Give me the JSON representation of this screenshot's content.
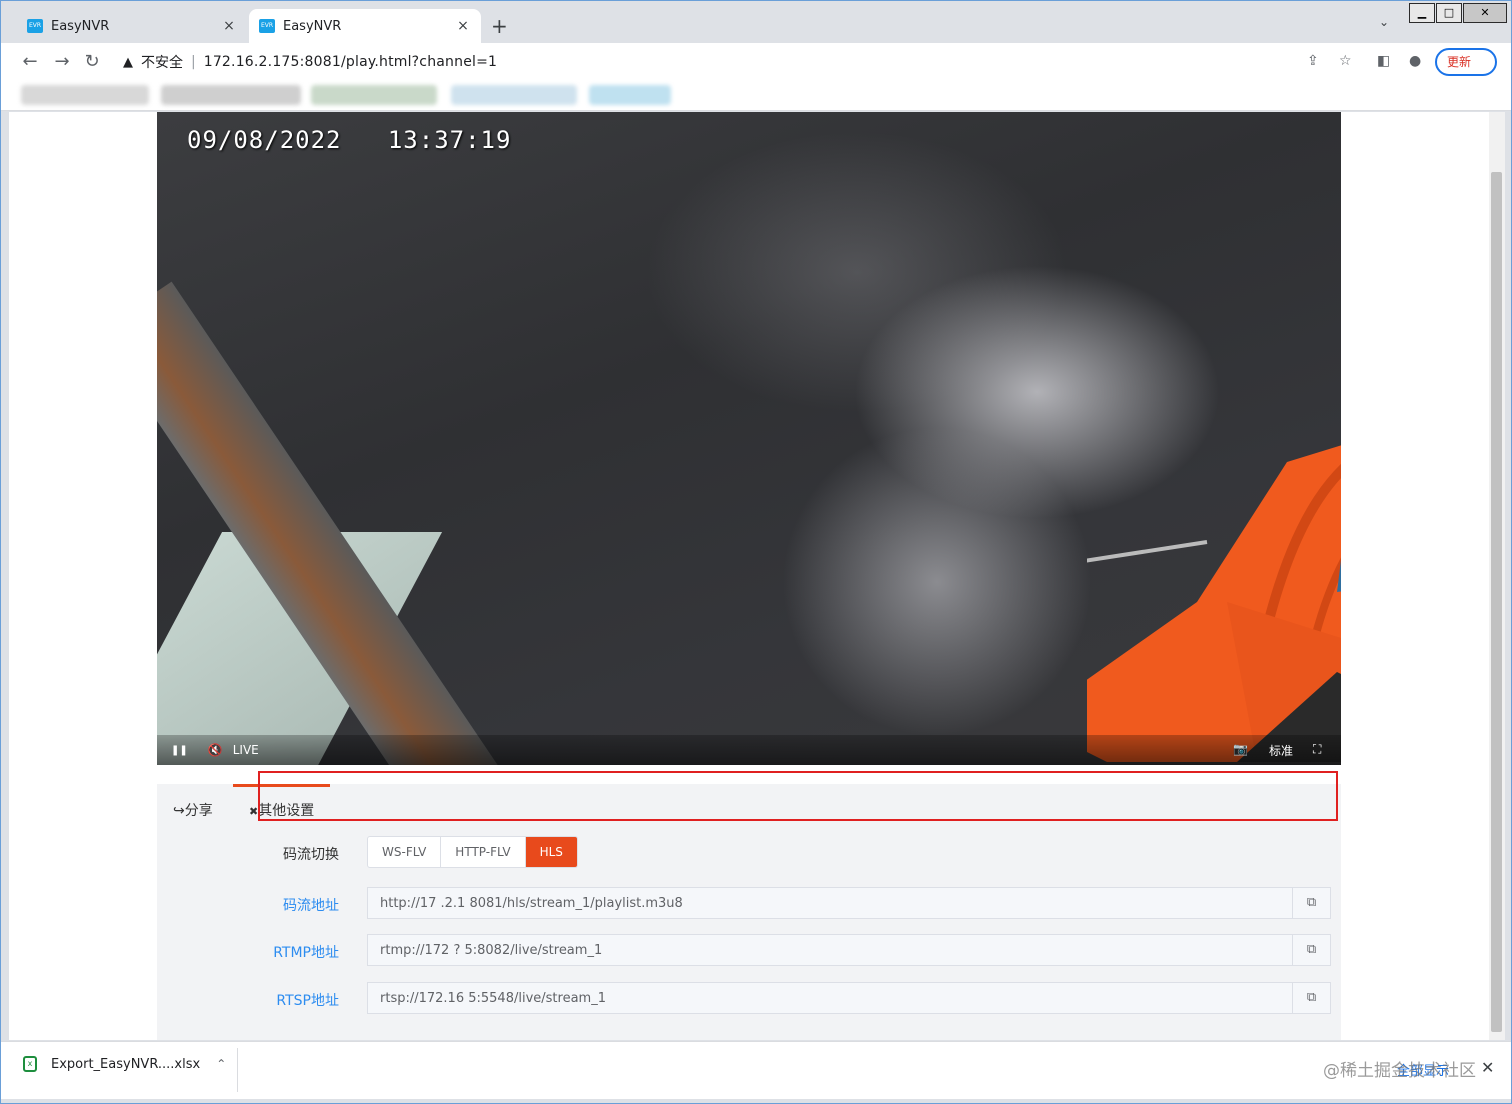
{
  "browser": {
    "tabs": [
      {
        "title": "EasyNVR",
        "favicon_text": "EVR",
        "close": "×"
      },
      {
        "title": "EasyNVR",
        "favicon_text": "EVR",
        "close": "×"
      }
    ],
    "new_tab": "+",
    "tab_search": "⌄",
    "window_controls": {
      "minimize": "▁",
      "maximize": "□",
      "close": "✕"
    },
    "nav": {
      "back": "←",
      "forward": "→",
      "reload": "↻"
    },
    "security_icon": "▲",
    "security_label": "不安全",
    "url": "172.16.2.175:8081/play.html?channel=1",
    "toolbar_icons": {
      "share": "⇪",
      "star": "☆",
      "sidepanel": "◧",
      "profile": "●",
      "menu": "⋮"
    },
    "update_label": "更新"
  },
  "video": {
    "timestamp": "09/08/2022   13:37:19",
    "controls": {
      "play": "❚❚",
      "mute": "🔇",
      "live": "LIVE",
      "snapshot": "📷",
      "quality": "标准",
      "fullscreen": "⛶"
    }
  },
  "panel": {
    "tabs": [
      {
        "icon": "↪",
        "label": "分享"
      },
      {
        "icon": "✖",
        "label": "其他设置"
      }
    ],
    "stream_switch_label": "码流切换",
    "stream_options": [
      "WS-FLV",
      "HTTP-FLV",
      "HLS"
    ],
    "selected_stream": "HLS",
    "fields": [
      {
        "label": "码流地址",
        "value": "http://17   .2.1     8081/hls/stream_1/playlist.m3u8",
        "copy": "⧉"
      },
      {
        "label": "RTMP地址",
        "value": "rtmp://172      ?     5:8082/live/stream_1",
        "copy": "⧉"
      },
      {
        "label": "RTSP地址",
        "value": "rtsp://172.16        5:5548/live/stream_1",
        "copy": "⧉"
      }
    ]
  },
  "downloads": {
    "file_name": "Export_EasyNVR....xlsx",
    "file_icon_text": "x",
    "chevron": "⌃",
    "show_all": "全部显示",
    "close": "✕",
    "watermark": "@稀土掘金技术社区"
  },
  "colors": {
    "accent": "#e84a1c",
    "link_blue": "#2d8cf0",
    "highlight_red": "#e02020",
    "chrome_blue": "#1a73e8"
  }
}
